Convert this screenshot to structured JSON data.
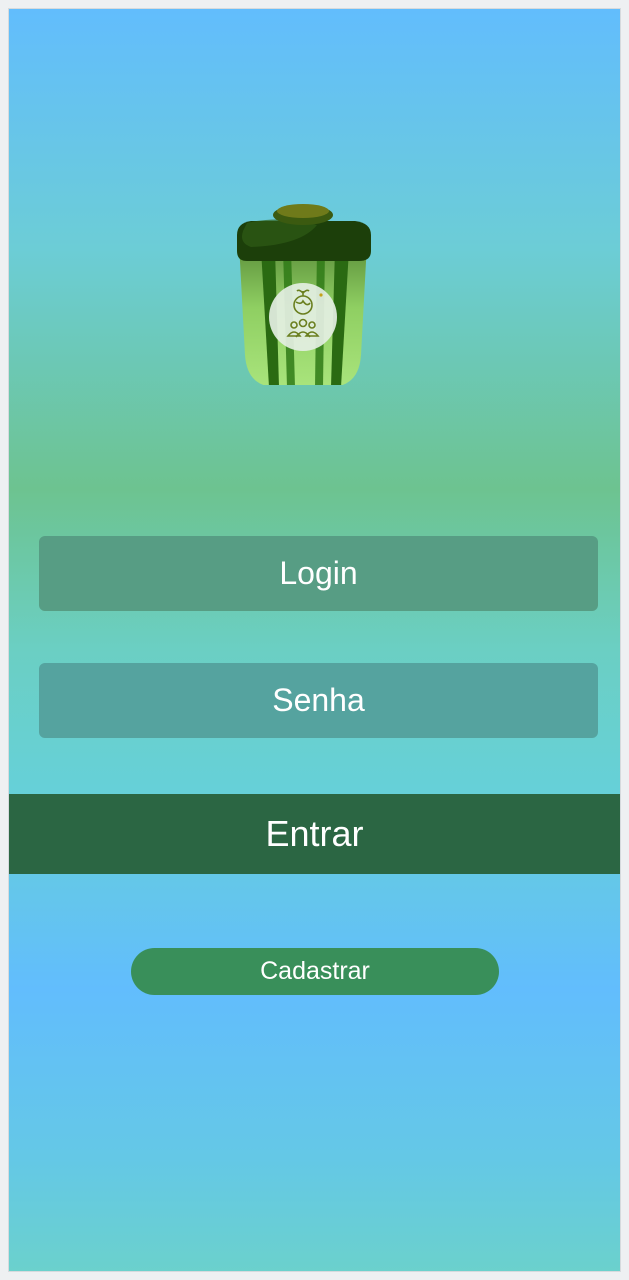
{
  "app": {
    "logo_icon": "recycling-bin-logo",
    "emblem_icon": "earth-community-icon"
  },
  "form": {
    "login_placeholder": "Login",
    "password_placeholder": "Senha"
  },
  "actions": {
    "submit_label": "Entrar",
    "register_label": "Cadastrar"
  },
  "colors": {
    "login_field": "#579d84",
    "password_field": "#55a39f",
    "submit_button": "#2b6643",
    "register_button": "#398f5a"
  }
}
